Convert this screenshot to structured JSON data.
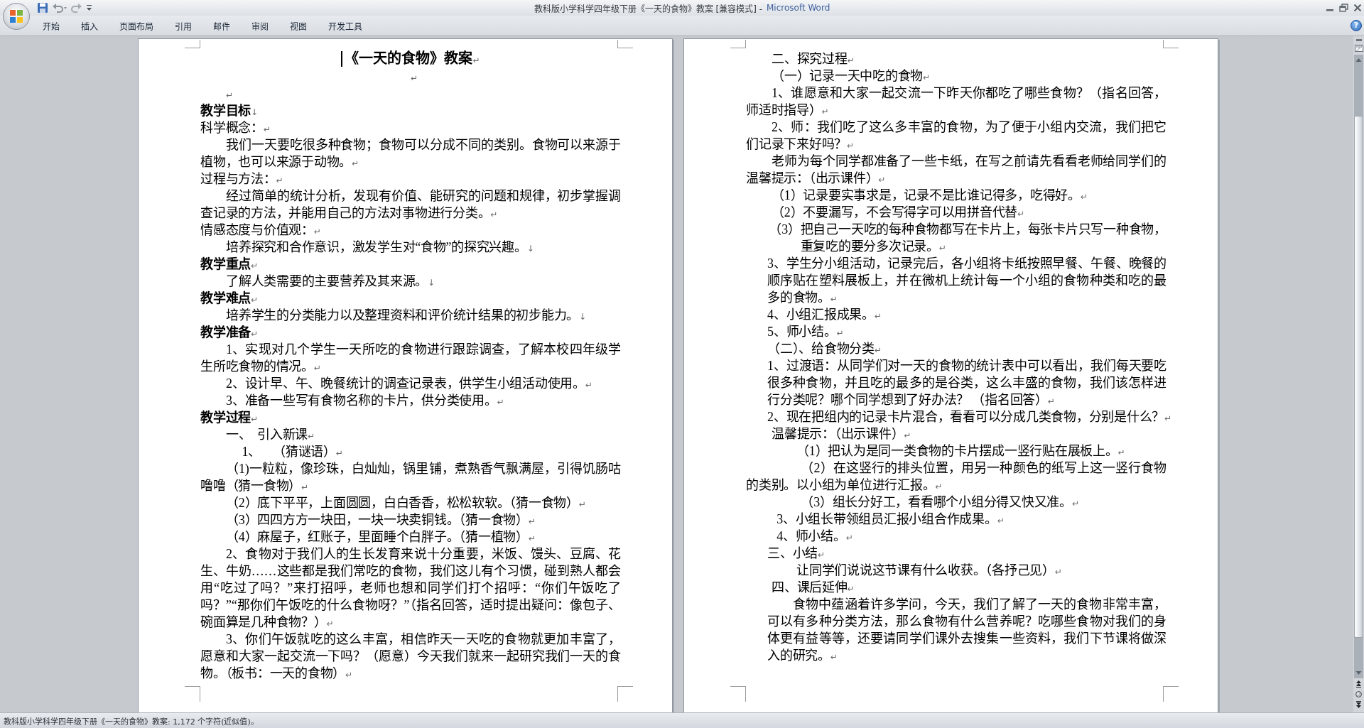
{
  "window": {
    "title": "教科版小学科学四年级下册《一天的食物》教案 [兼容模式] -",
    "app_name": "Microsoft Word"
  },
  "ribbon_tabs": [
    {
      "label": "开始",
      "selected": false
    },
    {
      "label": "插入",
      "selected": false
    },
    {
      "label": "页面布局",
      "selected": false
    },
    {
      "label": "引用",
      "selected": false
    },
    {
      "label": "邮件",
      "selected": false
    },
    {
      "label": "审阅",
      "selected": false
    },
    {
      "label": "视图",
      "selected": false
    },
    {
      "label": "开发工具",
      "selected": false
    }
  ],
  "help_button": "?",
  "pages": [
    {
      "paragraphs": [
        {
          "kind": "title",
          "text": "《一天的食物》教案",
          "end": "↵",
          "caret": true
        },
        {
          "kind": "center",
          "end": "↵"
        },
        {
          "kind": "indent",
          "end": "↵"
        },
        {
          "kind": "heading",
          "text": "教学目标",
          "end": "↓"
        },
        {
          "kind": "plain",
          "text": "科学概念：",
          "end": "↵"
        },
        {
          "kind": "indent",
          "text": "我们一天要吃很多种食物；食物可以分成不同的类别。食物可以来源于植物，也可以来源于动物。",
          "end": "↵"
        },
        {
          "kind": "plain",
          "text": "过程与方法：",
          "end": "↵"
        },
        {
          "kind": "indent",
          "text": "经过简单的统计分析，发现有价值、能研究的问题和规律，初步掌握调查记录的方法，并能用自己的方法对事物进行分类。",
          "end": "↵"
        },
        {
          "kind": "plain",
          "text": "情感态度与价值观：",
          "end": "↵"
        },
        {
          "kind": "indent",
          "text": "培养探究和合作意识，激发学生对“食物”的探究兴趣。",
          "end": "↓"
        },
        {
          "kind": "heading",
          "text": "教学重点",
          "end": "↵"
        },
        {
          "kind": "indent",
          "text": "了解人类需要的主要营养及其来源。",
          "end": "↓"
        },
        {
          "kind": "heading",
          "text": "教学难点",
          "end": "↵"
        },
        {
          "kind": "indent",
          "text": "培养学生的分类能力以及整理资料和评价统计结果的初步能力。",
          "end": "↓"
        },
        {
          "kind": "heading",
          "text": "教学准备",
          "end": "↵"
        },
        {
          "kind": "indent",
          "text": "1、实现对几个学生一天所吃的食物进行跟踪调查，了解本校四年级学生所吃食物的情况。",
          "end": "↵"
        },
        {
          "kind": "indent",
          "text": "2、设计早、午、晚餐统计的调查记录表，供学生小组活动使用。",
          "end": "↵"
        },
        {
          "kind": "indent",
          "text": "3、准备一些写有食物名称的卡片，供分类使用。",
          "end": "↵"
        },
        {
          "kind": "heading",
          "text": "教学过程",
          "end": "↵"
        },
        {
          "kind": "indent",
          "text": "一、  引入新课",
          "end": "↵"
        },
        {
          "kind": "step",
          "text": "1、    （猜谜语）",
          "end": "↵"
        },
        {
          "kind": "indent",
          "text": "（1)一粒粒，像珍珠，白灿灿，锅里铺，煮熟香气飘满屋，引得饥肠咕噜噜（猜一食物）",
          "end": "↵"
        },
        {
          "kind": "indent",
          "text": "（2）底下平平，上面圆圆，白白香香，松松软软。（猜一食物）",
          "end": "↵"
        },
        {
          "kind": "indent",
          "text": "（3）四四方方一块田，一块一块卖铜钱。（猜一食物）",
          "end": "↵"
        },
        {
          "kind": "indent",
          "text": "（4）麻屋子，红账子，里面睡个白胖子。（猜一植物）",
          "end": "↵"
        },
        {
          "kind": "indent",
          "text": "2、食物对于我们人的生长发育来说十分重要，米饭、馒头、豆腐、花生、牛奶……这些都是我们常吃的食物，我们这儿有个习惯，碰到熟人都会用“吃过了吗？”来打招呼，老师也想和同学们打个招呼：“你们午饭吃了吗？”“那你们午饭吃的什么食物呀？”（指名回答，适时提出疑问：像包子、碗面算是几种食物？）",
          "end": "↵"
        },
        {
          "kind": "indent",
          "text": "3、你们午饭就吃的这么丰富，相信昨天一天吃的食物就更加丰富了，愿意和大家一起交流一下吗？（愿意）今天我们就来一起研究我们一天的食物。（板书：一天的食物）",
          "end": "↵"
        }
      ]
    },
    {
      "paragraphs": [
        {
          "kind": "indent",
          "text": "二、探究过程",
          "end": "↵"
        },
        {
          "kind": "indent",
          "text": "（一）记录一天中吃的食物",
          "end": "↵"
        },
        {
          "kind": "indent",
          "text": "1、谁愿意和大家一起交流一下昨天你都吃了哪些食物？（指名回答，师适时指导）",
          "end": "↵"
        },
        {
          "kind": "indent",
          "text": "2、师：我们吃了这么多丰富的食物，为了便于小组内交流，我们把它们记录下来好吗？",
          "end": "↵"
        },
        {
          "kind": "indent",
          "text": "老师为每个同学都准备了一些卡纸，在写之前请先看看老师给同学们的温馨提示：（出示课件）",
          "end": "↵"
        },
        {
          "kind": "indent",
          "text": "（1）记录要实事求是，记录不是比谁记得多，吃得好。",
          "end": "↵"
        },
        {
          "kind": "indent",
          "text": "（2）不要漏写，不会写得字可以用拼音代替",
          "end": "↵"
        },
        {
          "kind": "hanging",
          "text": "（3）把自己一天吃的每种食物都写在卡片上，每张卡片只写一种食物，重复吃的要分多次记录。",
          "end": "↵"
        },
        {
          "kind": "block",
          "text": "3、学生分小组活动，记录完后，各小组将卡纸按照早餐、午餐、晚餐的顺序贴在塑料展板上，并在微机上统计每一个小组的食物种类和吃的最多的食物。",
          "end": "↵"
        },
        {
          "kind": "block",
          "text": "4、小组汇报成果。",
          "end": "↵"
        },
        {
          "kind": "block",
          "text": "5、师小结。",
          "end": "↵"
        },
        {
          "kind": "block",
          "text": "（二）、给食物分类",
          "end": "↵"
        },
        {
          "kind": "block",
          "text": "1、过渡语：从同学们对一天的食物的统计表中可以看出，我们每天要吃很多种食物，并且吃的最多的是谷类，这么丰盛的食物，我们该怎样进行分类呢？哪个同学想到了好办法？ （指名回答）",
          "end": "↵"
        },
        {
          "kind": "block",
          "text": "2、现在把组内的记录卡片混合，看看可以分成几类食物，分别是什么？",
          "end": "↵"
        },
        {
          "kind": "indent",
          "text": "温馨提示：（出示课件）",
          "end": "↵"
        },
        {
          "kind": "deep",
          "text": "（1）把认为是同一类食物的卡片摆成一竖行贴在展板上。",
          "end": "↵"
        },
        {
          "kind": "deeper",
          "text": "（2）在这竖行的排头位置，用另一种颜色的纸写上这一竖行食物的类别。以小组为单位进行汇报。",
          "end": "↵"
        },
        {
          "kind": "deeper",
          "text": "（3）组长分好工，看看哪个小组分得又快又准。",
          "end": "↵"
        },
        {
          "kind": "sub",
          "text": "3、小组长带领组员汇报小组合作成果。",
          "end": "↵"
        },
        {
          "kind": "sub",
          "text": "4、师小结。",
          "end": "↵"
        },
        {
          "kind": "block",
          "text": "三、小结",
          "end": "↵"
        },
        {
          "kind": "deep",
          "text": "让同学们说说这节课有什么收获。（各抒己见）",
          "end": "↵"
        },
        {
          "kind": "indent",
          "text": "四、课后延伸",
          "end": "↵"
        },
        {
          "kind": "lead",
          "text": "食物中蕴涵着许多学问，今天，我们了解了一天的食物非常丰富，可以有多种分类方法，那么食物有什么营养呢？吃哪些食物对我们的身体更有益等等，还要请同学们课外去搜集一些资料，我们下节课将做深入的研究。",
          "end": "↵"
        }
      ]
    }
  ],
  "status_bar": {
    "text": "教科版小学科学四年级下册《一天的食物》教案: 1,172 个字符(近似值)。"
  }
}
